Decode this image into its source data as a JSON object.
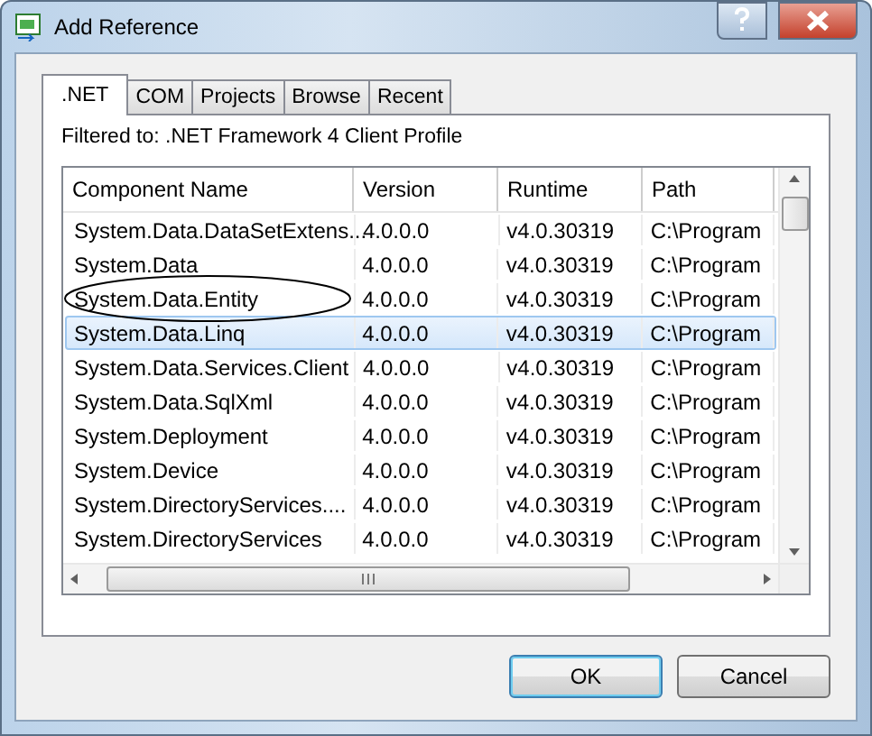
{
  "window": {
    "title": "Add Reference"
  },
  "tabs": [
    {
      "label": ".NET",
      "selected": true
    },
    {
      "label": "COM",
      "selected": false
    },
    {
      "label": "Projects",
      "selected": false
    },
    {
      "label": "Browse",
      "selected": false
    },
    {
      "label": "Recent",
      "selected": false
    }
  ],
  "filter_text": "Filtered to: .NET Framework 4 Client Profile",
  "table": {
    "columns": [
      "Component Name",
      "Version",
      "Runtime",
      "Path"
    ],
    "rows": [
      {
        "cells": [
          "System.Data.DataSetExtens...",
          "4.0.0.0",
          "v4.0.30319",
          "C:\\Program"
        ],
        "selected": false,
        "circled": false
      },
      {
        "cells": [
          "System.Data",
          "4.0.0.0",
          "v4.0.30319",
          "C:\\Program"
        ],
        "selected": false,
        "circled": false
      },
      {
        "cells": [
          "System.Data.Entity",
          "4.0.0.0",
          "v4.0.30319",
          "C:\\Program"
        ],
        "selected": false,
        "circled": true
      },
      {
        "cells": [
          "System.Data.Linq",
          "4.0.0.0",
          "v4.0.30319",
          "C:\\Program"
        ],
        "selected": true,
        "circled": false
      },
      {
        "cells": [
          "System.Data.Services.Client",
          "4.0.0.0",
          "v4.0.30319",
          "C:\\Program"
        ],
        "selected": false,
        "circled": false
      },
      {
        "cells": [
          "System.Data.SqlXml",
          "4.0.0.0",
          "v4.0.30319",
          "C:\\Program"
        ],
        "selected": false,
        "circled": false
      },
      {
        "cells": [
          "System.Deployment",
          "4.0.0.0",
          "v4.0.30319",
          "C:\\Program"
        ],
        "selected": false,
        "circled": false
      },
      {
        "cells": [
          "System.Device",
          "4.0.0.0",
          "v4.0.30319",
          "C:\\Program"
        ],
        "selected": false,
        "circled": false
      },
      {
        "cells": [
          "System.DirectoryServices....",
          "4.0.0.0",
          "v4.0.30319",
          "C:\\Program"
        ],
        "selected": false,
        "circled": false
      },
      {
        "cells": [
          "System.DirectoryServices",
          "4.0.0.0",
          "v4.0.30319",
          "C:\\Program"
        ],
        "selected": false,
        "circled": false
      }
    ]
  },
  "buttons": [
    "OK",
    "Cancel"
  ]
}
